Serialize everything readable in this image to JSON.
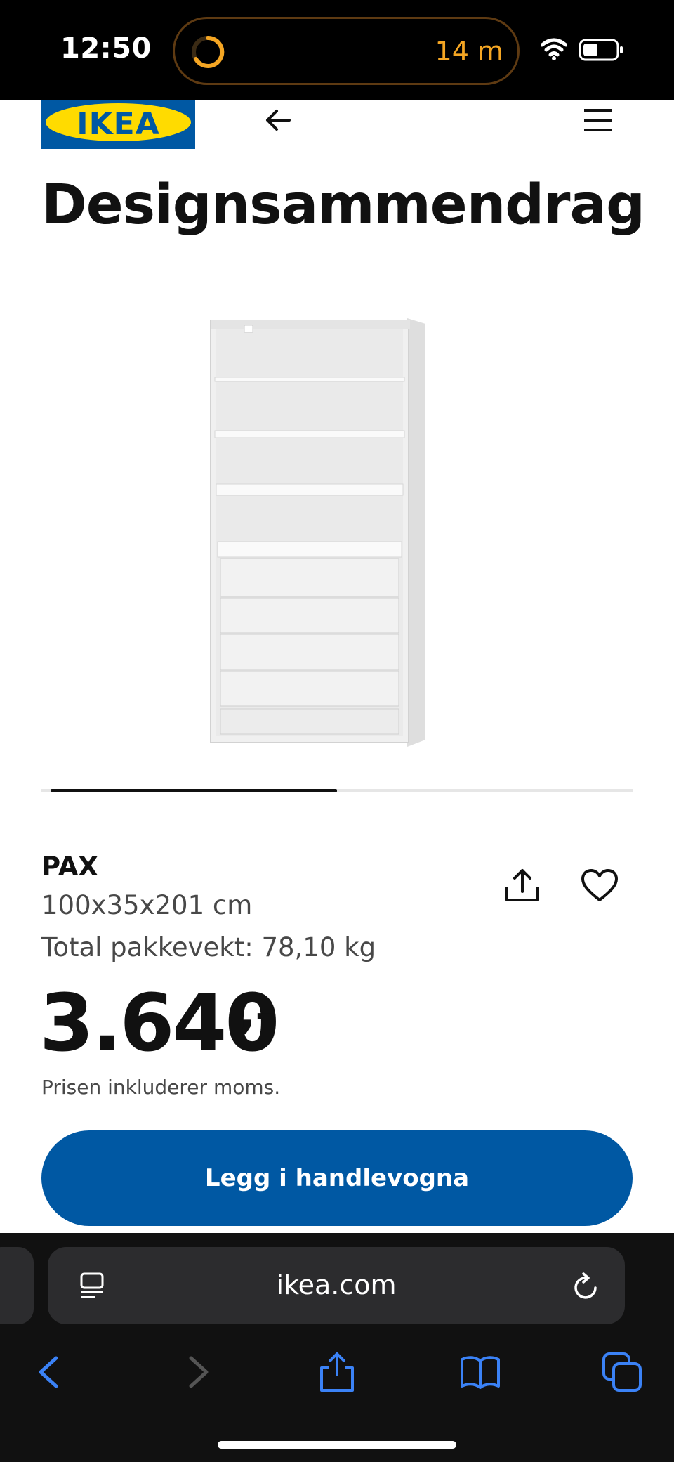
{
  "status_bar": {
    "time": "12:50",
    "timer": "14 m",
    "accent_color": "#f5a623"
  },
  "header": {
    "logo_text": "IKEA",
    "back_icon": "arrow-left-icon",
    "menu_icon": "hamburger-menu-icon"
  },
  "page": {
    "title": "Designsammendrag"
  },
  "carousel": {
    "position_fraction": 0.5,
    "total": 2
  },
  "product": {
    "name": "PAX",
    "dimensions": "100x35x201 cm",
    "weight": "Total pakkevekt: 78,10 kg",
    "price": "3.640",
    "price_suffix": ",–",
    "price_note": "Prisen inkluderer moms.",
    "add_to_cart_label": "Legg i handlevogna",
    "brand_color": "#0058a3"
  },
  "browser": {
    "url": "ikea.com",
    "toolbar_icons": [
      "back-icon",
      "forward-icon",
      "share-icon",
      "bookmarks-icon",
      "tabs-icon"
    ],
    "accent_color": "#3b82f6"
  }
}
